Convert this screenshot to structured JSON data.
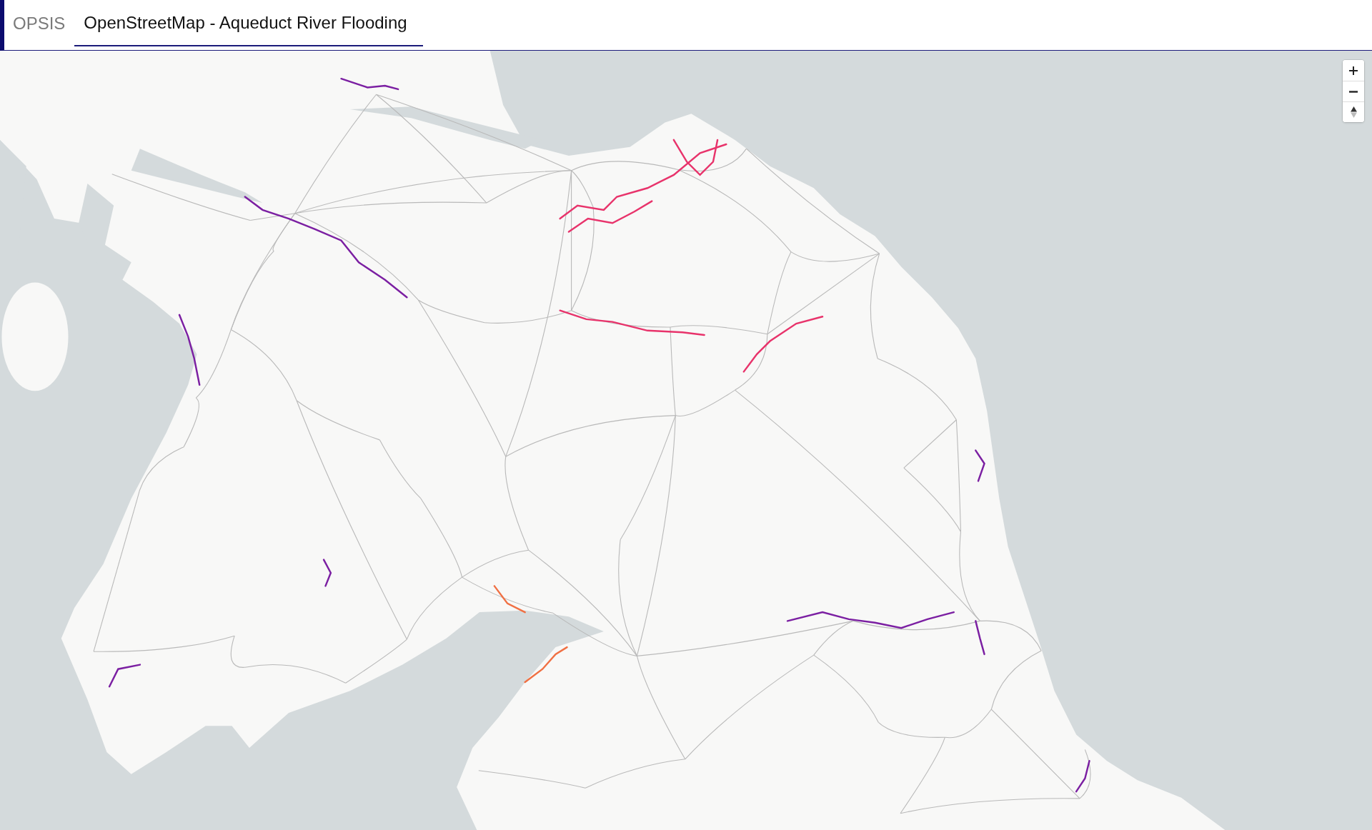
{
  "header": {
    "brand": "OPSIS",
    "tabs": [
      {
        "label": "OpenStreetMap - Aqueduct River Flooding",
        "selected": true
      }
    ]
  }
}
